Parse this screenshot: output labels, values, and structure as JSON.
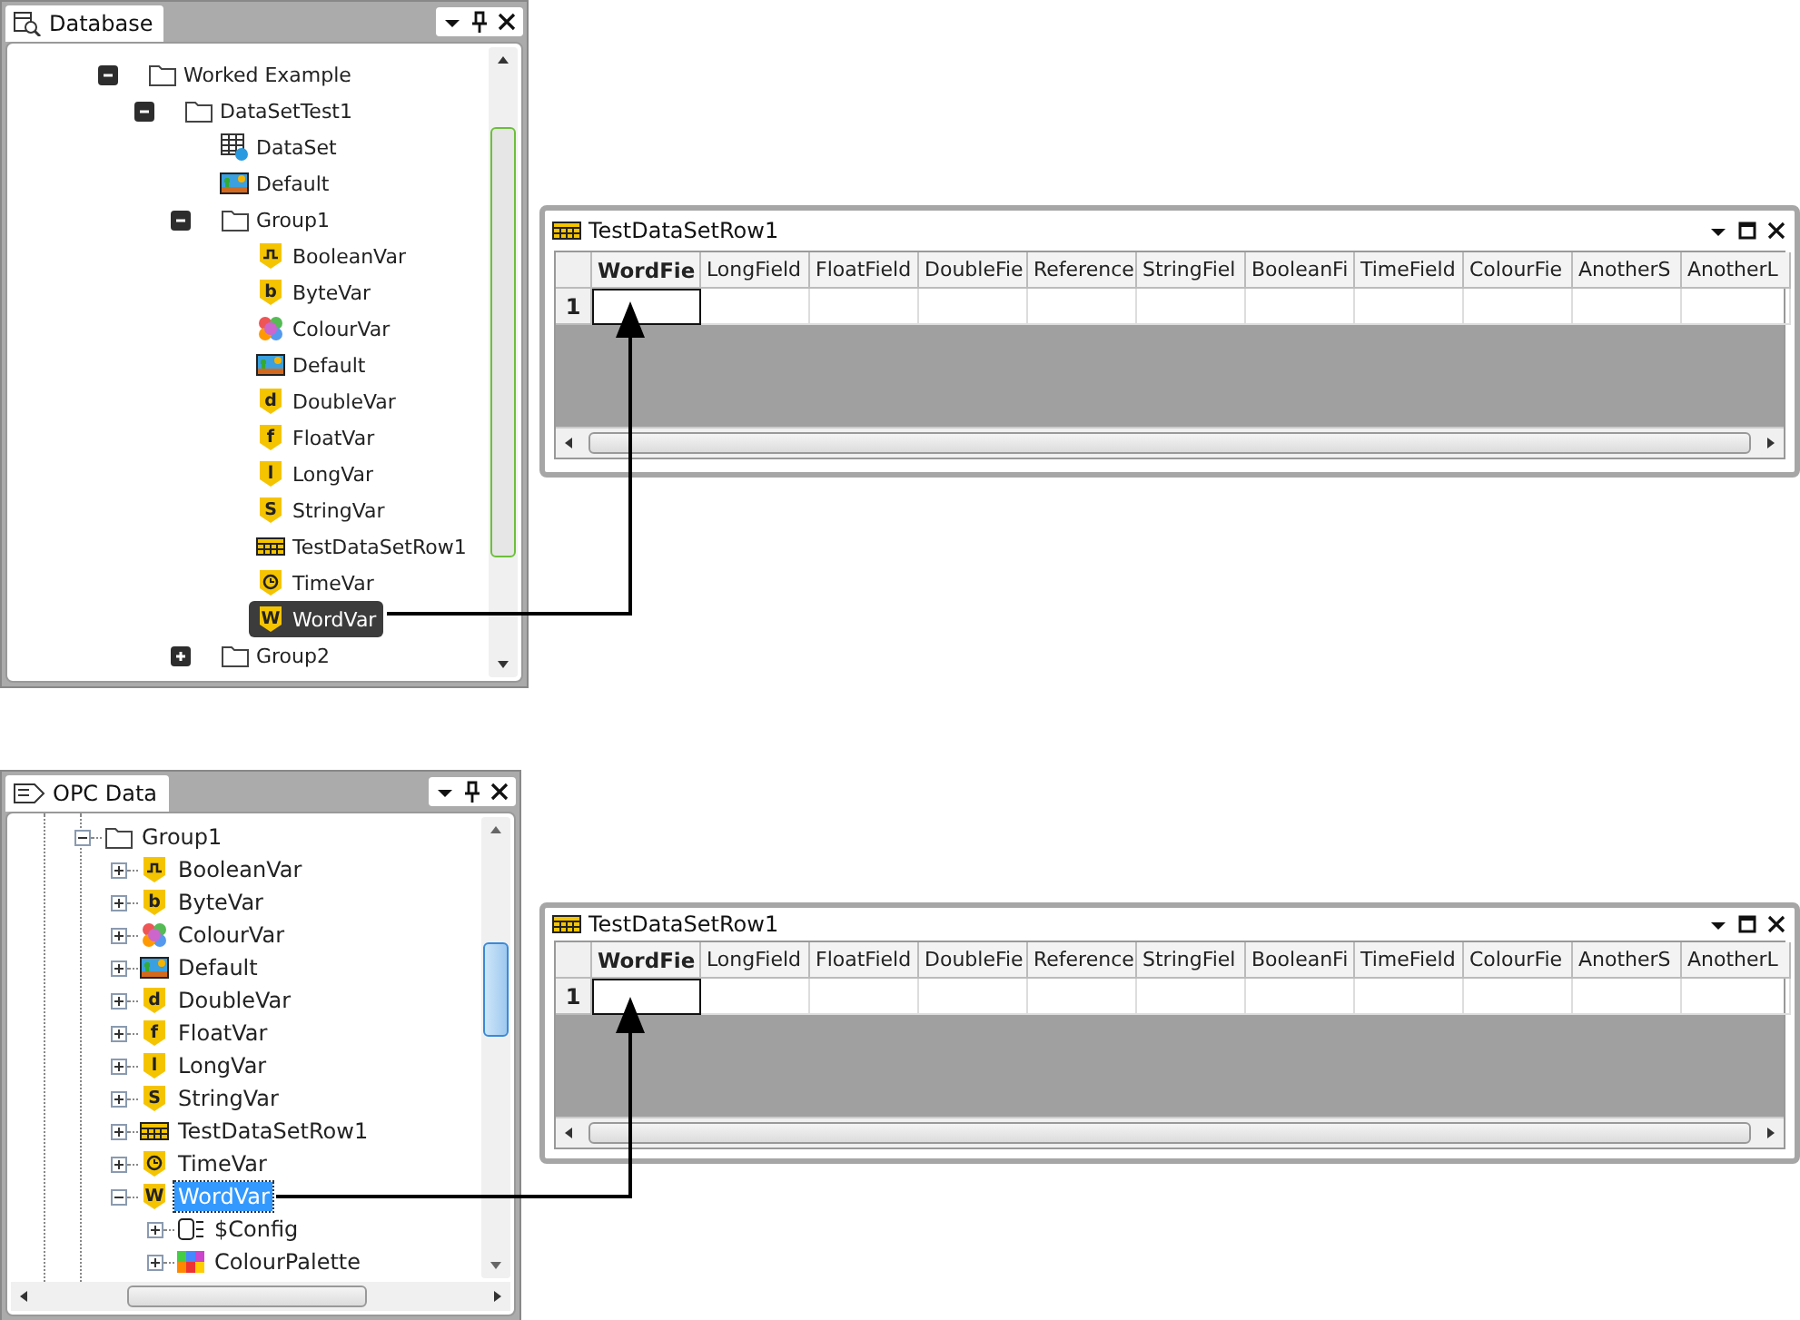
{
  "database_panel": {
    "tab": "Database",
    "tree": [
      {
        "label": "Worked Example",
        "kind": "folder",
        "expanded": true,
        "selected": false,
        "children": [
          {
            "label": "DataSetTest1",
            "kind": "folder",
            "expanded": true,
            "selected": false,
            "children": [
              {
                "label": "DataSet",
                "kind": "dataset",
                "selected": false
              },
              {
                "label": "Default",
                "kind": "picture",
                "selected": false
              },
              {
                "label": "Group1",
                "kind": "folder",
                "expanded": true,
                "selected": false,
                "children": [
                  {
                    "label": "BooleanVar",
                    "kind": "boolean",
                    "selected": false
                  },
                  {
                    "label": "ByteVar",
                    "kind": "letter",
                    "glyph": "b",
                    "selected": false
                  },
                  {
                    "label": "ColourVar",
                    "kind": "colour",
                    "selected": false
                  },
                  {
                    "label": "Default",
                    "kind": "picture",
                    "selected": false
                  },
                  {
                    "label": "DoubleVar",
                    "kind": "letter",
                    "glyph": "d",
                    "selected": false
                  },
                  {
                    "label": "FloatVar",
                    "kind": "letter",
                    "glyph": "f",
                    "selected": false
                  },
                  {
                    "label": "LongVar",
                    "kind": "letter",
                    "glyph": "l",
                    "selected": false
                  },
                  {
                    "label": "StringVar",
                    "kind": "letter",
                    "glyph": "S",
                    "selected": false
                  },
                  {
                    "label": "TestDataSetRow1",
                    "kind": "table",
                    "selected": false
                  },
                  {
                    "label": "TimeVar",
                    "kind": "time",
                    "selected": false
                  },
                  {
                    "label": "WordVar",
                    "kind": "letter",
                    "glyph": "W",
                    "selected": true
                  }
                ]
              },
              {
                "label": "Group2",
                "kind": "folder",
                "expanded": false,
                "selected": false
              }
            ]
          }
        ]
      }
    ]
  },
  "opc_panel": {
    "tab": "OPC Data",
    "tree": [
      {
        "label": "Group1",
        "kind": "folder",
        "expanded": true,
        "selected": false,
        "children": [
          {
            "label": "BooleanVar",
            "kind": "boolean",
            "expanded": false,
            "selected": false
          },
          {
            "label": "ByteVar",
            "kind": "letter",
            "glyph": "b",
            "expanded": false,
            "selected": false
          },
          {
            "label": "ColourVar",
            "kind": "colour",
            "expanded": false,
            "selected": false
          },
          {
            "label": "Default",
            "kind": "picture",
            "expanded": false,
            "selected": false
          },
          {
            "label": "DoubleVar",
            "kind": "letter",
            "glyph": "d",
            "expanded": false,
            "selected": false
          },
          {
            "label": "FloatVar",
            "kind": "letter",
            "glyph": "f",
            "expanded": false,
            "selected": false
          },
          {
            "label": "LongVar",
            "kind": "letter",
            "glyph": "l",
            "expanded": false,
            "selected": false
          },
          {
            "label": "StringVar",
            "kind": "letter",
            "glyph": "S",
            "expanded": false,
            "selected": false
          },
          {
            "label": "TestDataSetRow1",
            "kind": "table",
            "expanded": false,
            "selected": false
          },
          {
            "label": "TimeVar",
            "kind": "time",
            "expanded": false,
            "selected": false
          },
          {
            "label": "WordVar",
            "kind": "letter",
            "glyph": "W",
            "expanded": true,
            "selected": true,
            "children": [
              {
                "label": "$Config",
                "kind": "config",
                "expanded": false,
                "selected": false
              },
              {
                "label": "ColourPalette",
                "kind": "palette",
                "expanded": false,
                "selected": false
              }
            ]
          }
        ]
      }
    ]
  },
  "grid_windows": [
    {
      "title": "TestDataSetRow1",
      "columns": [
        {
          "label": "WordFie",
          "selected": true
        },
        {
          "label": "LongField",
          "selected": false
        },
        {
          "label": "FloatField",
          "selected": false
        },
        {
          "label": "DoubleFie",
          "selected": false
        },
        {
          "label": "Reference",
          "selected": false
        },
        {
          "label": "StringFiel",
          "selected": false
        },
        {
          "label": "BooleanFi",
          "selected": false
        },
        {
          "label": "TimeField",
          "selected": false
        },
        {
          "label": "ColourFie",
          "selected": false
        },
        {
          "label": "AnotherS",
          "selected": false
        },
        {
          "label": "AnotherL",
          "selected": false
        }
      ],
      "rows": [
        {
          "number": "1"
        }
      ]
    },
    {
      "title": "TestDataSetRow1",
      "columns": [
        {
          "label": "WordFie",
          "selected": true
        },
        {
          "label": "LongField",
          "selected": false
        },
        {
          "label": "FloatField",
          "selected": false
        },
        {
          "label": "DoubleFie",
          "selected": false
        },
        {
          "label": "Reference",
          "selected": false
        },
        {
          "label": "StringFiel",
          "selected": false
        },
        {
          "label": "BooleanFi",
          "selected": false
        },
        {
          "label": "TimeField",
          "selected": false
        },
        {
          "label": "ColourFie",
          "selected": false
        },
        {
          "label": "AnotherS",
          "selected": false
        },
        {
          "label": "AnotherL",
          "selected": false
        }
      ],
      "rows": [
        {
          "number": "1"
        }
      ]
    }
  ]
}
